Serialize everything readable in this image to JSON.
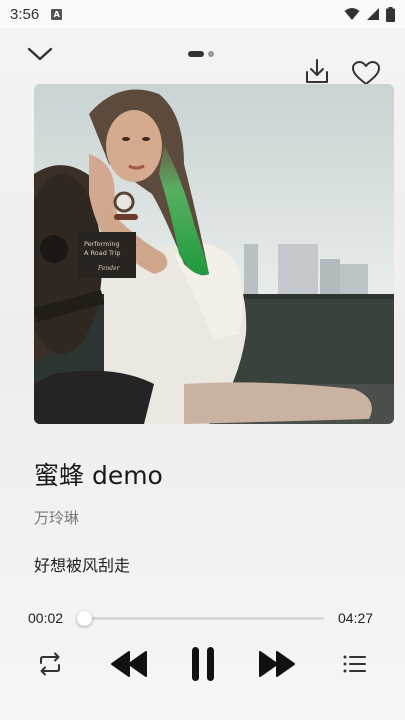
{
  "status_bar": {
    "time": "3:56",
    "notification_glyph": "A",
    "icons": [
      "wifi-icon",
      "signal-icon",
      "battery-icon"
    ]
  },
  "top": {
    "collapse_icon": "chevron-down-icon",
    "download_icon": "download-icon",
    "like_icon": "heart-icon",
    "page_count": 2,
    "active_page": 1
  },
  "album": {
    "guitar_text_line1": "Performing",
    "guitar_text_line2": "A Road Trip",
    "guitar_brand": "Fender"
  },
  "song": {
    "title": "蜜蜂 demo",
    "artist": "万玲琳",
    "lyric": "好想被风刮走"
  },
  "player": {
    "current_time": "00:02",
    "total_time": "04:27",
    "progress": 0.008,
    "state": "playing"
  },
  "controls": {
    "repeat_icon": "repeat-icon",
    "prev_icon": "previous-track-icon",
    "pause_icon": "pause-icon",
    "next_icon": "next-track-icon",
    "playlist_icon": "playlist-icon"
  }
}
